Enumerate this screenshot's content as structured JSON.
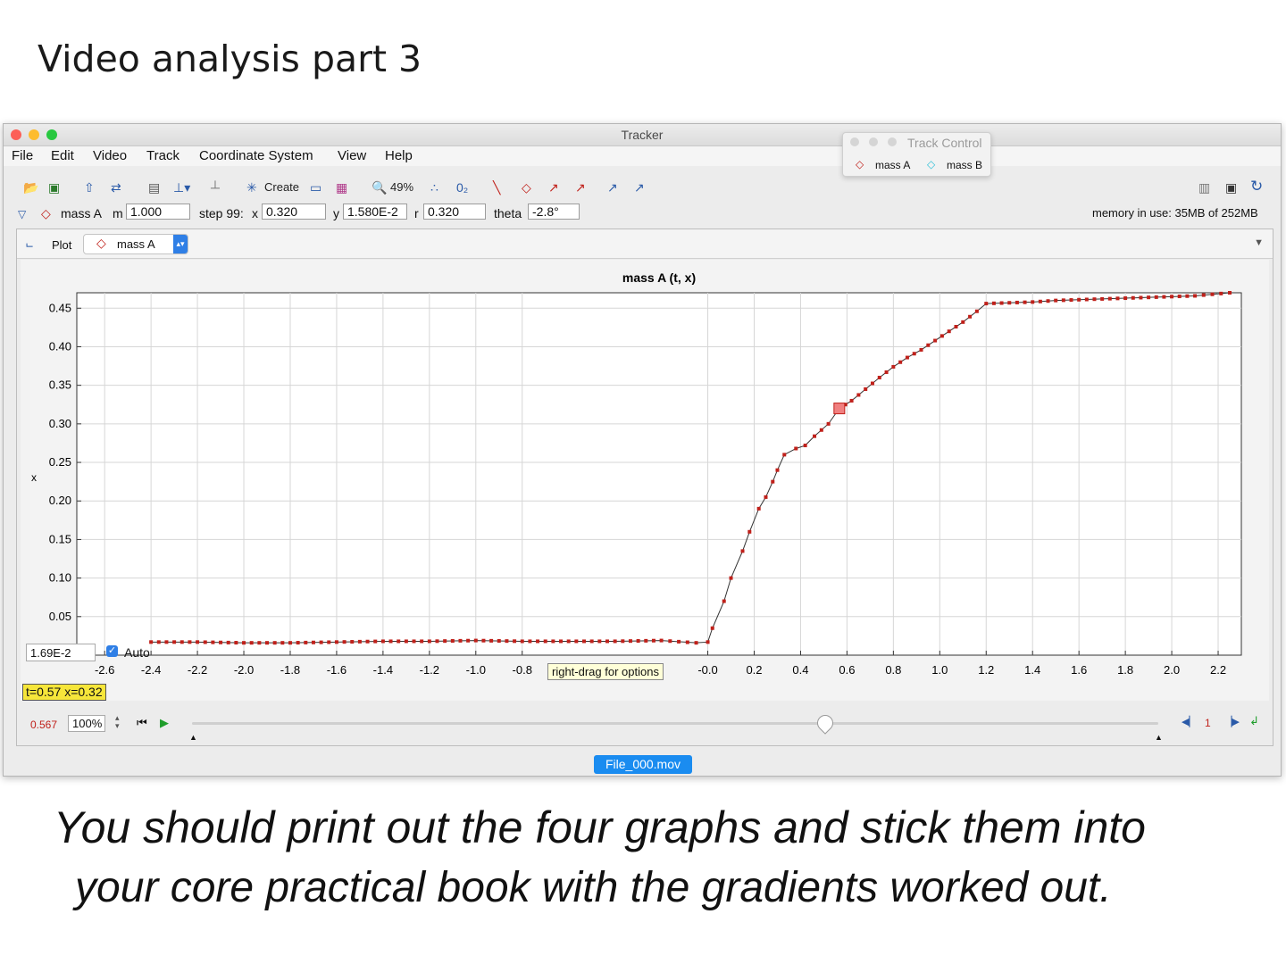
{
  "slide": {
    "title": "Video analysis part 3"
  },
  "window": {
    "title": "Tracker"
  },
  "menu": [
    "File",
    "Edit",
    "Video",
    "Track",
    "Coordinate System",
    "View",
    "Help"
  ],
  "toolbar": {
    "create_label": "Create",
    "zoom_label": "49%",
    "memory": "memory in use: 35MB of 252MB"
  },
  "trackbar": {
    "track_name": "mass A",
    "m_label": "m",
    "m_value": "1.000",
    "step_label": "step 99:",
    "x_label": "x",
    "x_value": "0.320",
    "y_label": "y",
    "y_value": "1.580E-2",
    "r_label": "r",
    "r_value": "0.320",
    "theta_label": "theta",
    "theta_value": "-2.8°"
  },
  "plot_header": {
    "plot_label": "Plot",
    "track_select": "mass A"
  },
  "track_control": {
    "title": "Track Control",
    "tracks": [
      "mass A",
      "mass B"
    ]
  },
  "plot_controls": {
    "min_field": "1.69E-2",
    "auto_label": "Auto",
    "readout": "t=0.57  x=0.32",
    "tooltip": "right-drag for options"
  },
  "playback": {
    "time": "0.567",
    "rate": "100%",
    "step": "1"
  },
  "video_file": "File_000.mov",
  "handwriting": {
    "line1": "You should print out the four graphs and stick them into",
    "line2": "your core practical book with the gradients worked out."
  },
  "colors": {
    "series": "#c0201a",
    "highlight": "#f08080",
    "file_button": "#1a8cf0"
  },
  "chart_data": {
    "type": "scatter",
    "title": "mass A (t, x)",
    "xlabel": "",
    "ylabel": "x",
    "xlim": [
      -2.72,
      2.3
    ],
    "ylim": [
      0.0,
      0.47
    ],
    "xticks": [
      -2.6,
      -2.4,
      -2.2,
      -2.0,
      -1.8,
      -1.6,
      -1.4,
      -1.2,
      -1.0,
      -0.8,
      -0.0,
      0.2,
      0.4,
      0.6,
      0.8,
      1.0,
      1.2,
      1.4,
      1.6,
      1.8,
      2.0,
      2.2
    ],
    "xtick_labels": [
      "-2.6",
      "-2.4",
      "-2.2",
      "-2.0",
      "-1.8",
      "-1.6",
      "-1.4",
      "-1.2",
      "-1.0",
      "-0.8",
      "-0.0",
      "0.2",
      "0.4",
      "0.6",
      "0.8",
      "1.0",
      "1.2",
      "1.4",
      "1.6",
      "1.8",
      "2.0",
      "2.2"
    ],
    "yticks": [
      0.05,
      0.1,
      0.15,
      0.2,
      0.25,
      0.3,
      0.35,
      0.4,
      0.45
    ],
    "ytick_labels": [
      "0.05",
      "0.10",
      "0.15",
      "0.20",
      "0.25",
      "0.30",
      "0.35",
      "0.40",
      "0.45"
    ],
    "grid": true,
    "highlight": {
      "t": 0.567,
      "x": 0.32
    },
    "series": [
      {
        "points": [
          [
            -2.4,
            0.017
          ],
          [
            -2.2,
            0.017
          ],
          [
            -2.0,
            0.016
          ],
          [
            -1.8,
            0.016
          ],
          [
            -1.6,
            0.017
          ],
          [
            -1.4,
            0.018
          ],
          [
            -1.2,
            0.018
          ],
          [
            -1.0,
            0.019
          ],
          [
            -0.8,
            0.018
          ],
          [
            -0.6,
            0.018
          ],
          [
            -0.4,
            0.018
          ],
          [
            -0.2,
            0.019
          ],
          [
            -0.05,
            0.016
          ],
          [
            0.0,
            0.017
          ],
          [
            0.02,
            0.035
          ],
          [
            0.07,
            0.07
          ],
          [
            0.1,
            0.1
          ],
          [
            0.15,
            0.135
          ],
          [
            0.18,
            0.16
          ],
          [
            0.22,
            0.19
          ],
          [
            0.25,
            0.205
          ],
          [
            0.28,
            0.225
          ],
          [
            0.3,
            0.24
          ],
          [
            0.33,
            0.26
          ],
          [
            0.38,
            0.268
          ],
          [
            0.42,
            0.272
          ],
          [
            0.46,
            0.284
          ],
          [
            0.52,
            0.3
          ],
          [
            0.567,
            0.32
          ],
          [
            0.62,
            0.33
          ],
          [
            0.68,
            0.345
          ],
          [
            0.74,
            0.36
          ],
          [
            0.8,
            0.374
          ],
          [
            0.86,
            0.386
          ],
          [
            0.92,
            0.396
          ],
          [
            0.98,
            0.408
          ],
          [
            1.04,
            0.42
          ],
          [
            1.1,
            0.432
          ],
          [
            1.16,
            0.446
          ],
          [
            1.2,
            0.456
          ],
          [
            1.3,
            0.457
          ],
          [
            1.4,
            0.458
          ],
          [
            1.5,
            0.46
          ],
          [
            1.6,
            0.461
          ],
          [
            1.7,
            0.462
          ],
          [
            1.8,
            0.463
          ],
          [
            1.9,
            0.464
          ],
          [
            2.0,
            0.465
          ],
          [
            2.1,
            0.466
          ],
          [
            2.25,
            0.47
          ]
        ]
      }
    ]
  }
}
